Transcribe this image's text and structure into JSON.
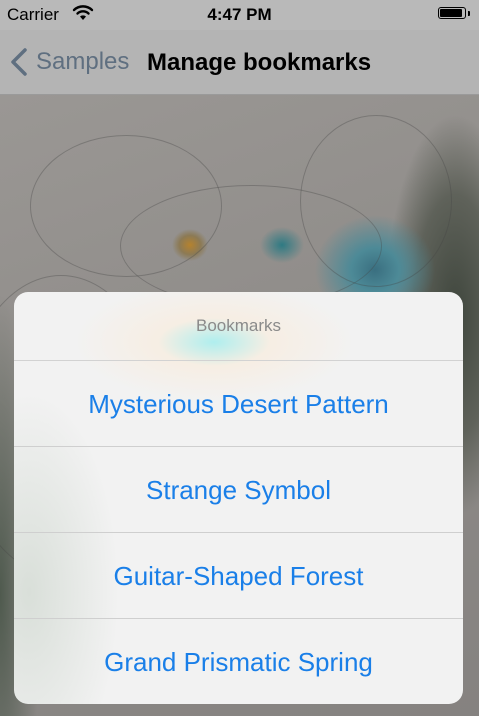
{
  "status_bar": {
    "carrier": "Carrier",
    "time": "4:47 PM",
    "wifi_icon": "wifi-icon",
    "battery_icon": "battery-icon"
  },
  "nav_bar": {
    "back_label": "Samples",
    "back_icon": "chevron-left-icon",
    "title": "Manage bookmarks"
  },
  "action_sheet": {
    "title": "Bookmarks",
    "items": [
      {
        "label": "Mysterious Desert Pattern"
      },
      {
        "label": "Strange Symbol"
      },
      {
        "label": "Guitar-Shaped Forest"
      },
      {
        "label": "Grand Prismatic Spring"
      }
    ]
  },
  "colors": {
    "accent": "#1a7fe8",
    "sheet_background": "#f2f2f2",
    "nav_background": "#b4b4b4"
  }
}
